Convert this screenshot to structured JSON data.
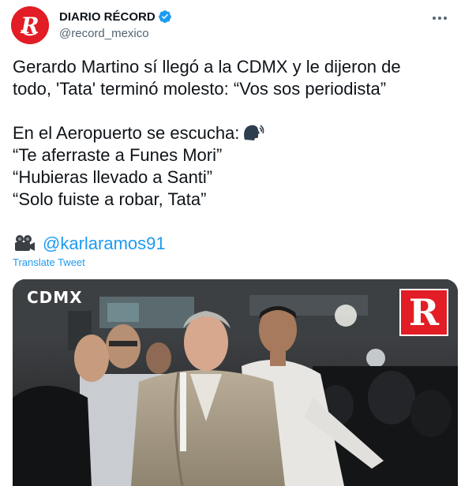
{
  "account": {
    "display_name": "DIARIO RÉCORD",
    "handle": "@record_mexico",
    "verified": true,
    "brand_color": "#e21d25"
  },
  "tweet": {
    "line1": "Gerardo Martino sí llegó a la CDMX y le dijeron de",
    "line2": "todo, 'Tata' terminó molesto: “Vos sos periodista”",
    "line3": "En el Aeropuerto se escucha:",
    "line4": "“Te aferraste a Funes Mori”",
    "line5": "“Hubieras llevado a Santi”",
    "line6": "“Solo fuiste a robar, Tata”",
    "mention": "@karlaramos91"
  },
  "translate_label": "Translate Tweet",
  "media": {
    "location_label": "CDMX",
    "logo_letter": "R"
  },
  "icons": {
    "speak": "speaking-head-icon",
    "camera": "movie-camera-icon",
    "verified": "verified-badge-icon",
    "more": "more-options-icon"
  },
  "colors": {
    "link": "#1d9bf0",
    "text": "#0f1419",
    "secondary": "#536471"
  }
}
